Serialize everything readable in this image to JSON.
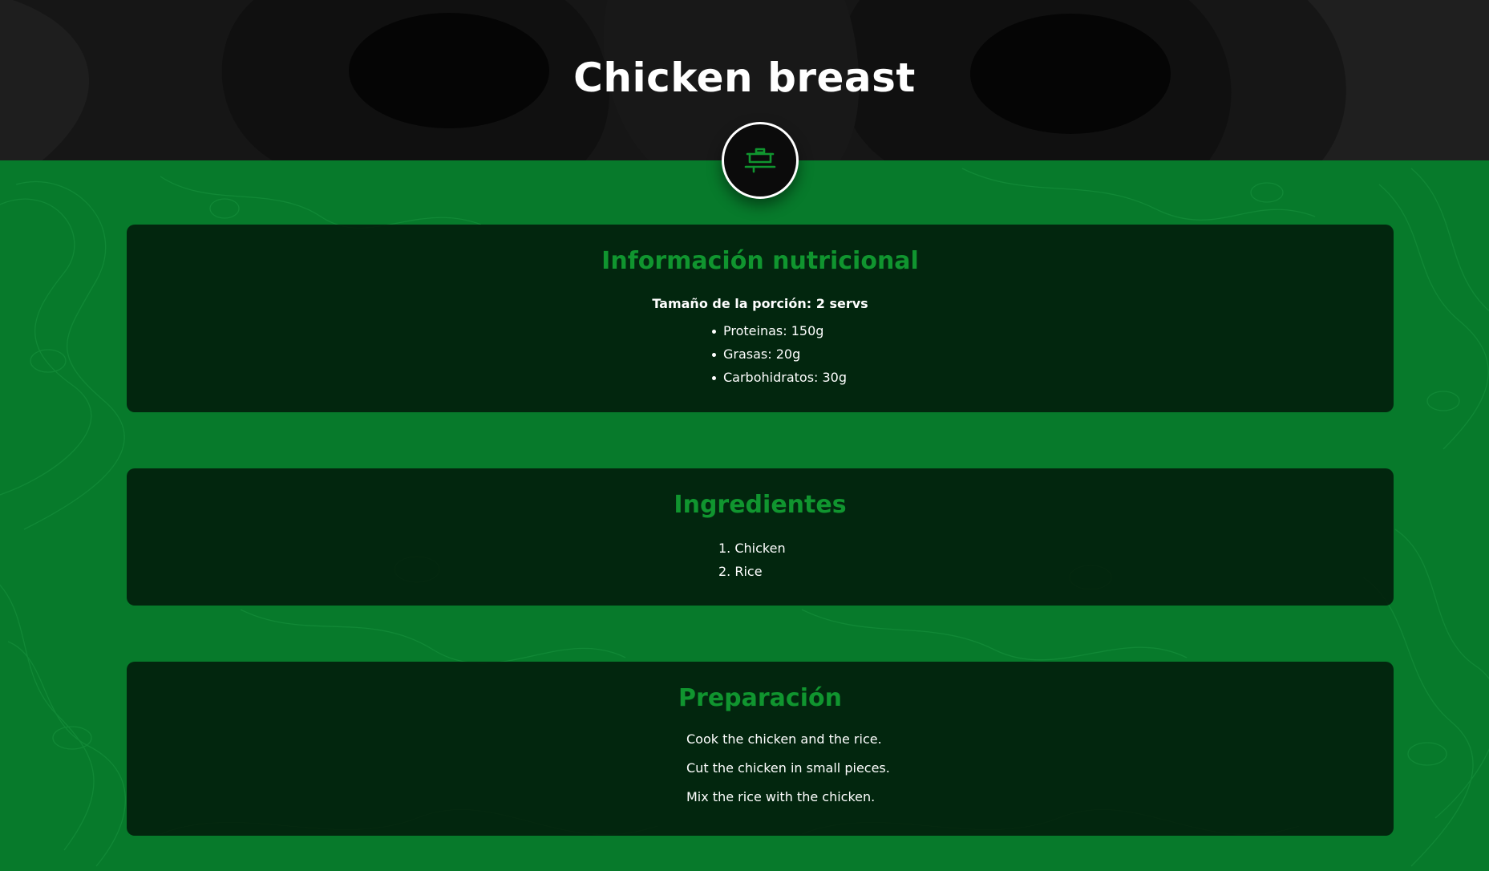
{
  "recipe": {
    "title": "Chicken breast",
    "icon": "cooking-pot-icon"
  },
  "nutrition": {
    "heading": "Información nutricional",
    "serving": "Tamaño de la porción: 2 servs",
    "items": [
      "Proteinas: 150g",
      "Grasas: 20g",
      "Carbohidratos: 30g"
    ]
  },
  "ingredients": {
    "heading": "Ingredientes",
    "items": [
      "1. Chicken",
      "2. Rice"
    ]
  },
  "preparation": {
    "heading": "Preparación",
    "steps": [
      "Cook the chicken and the rice.",
      "Cut the chicken in small pieces.",
      "Mix the rice with the chicken."
    ]
  },
  "colors": {
    "header_bg": "#141414",
    "green_bg": "#077a2b",
    "heading_green": "#10952f",
    "card_bg": "#021a0a"
  }
}
